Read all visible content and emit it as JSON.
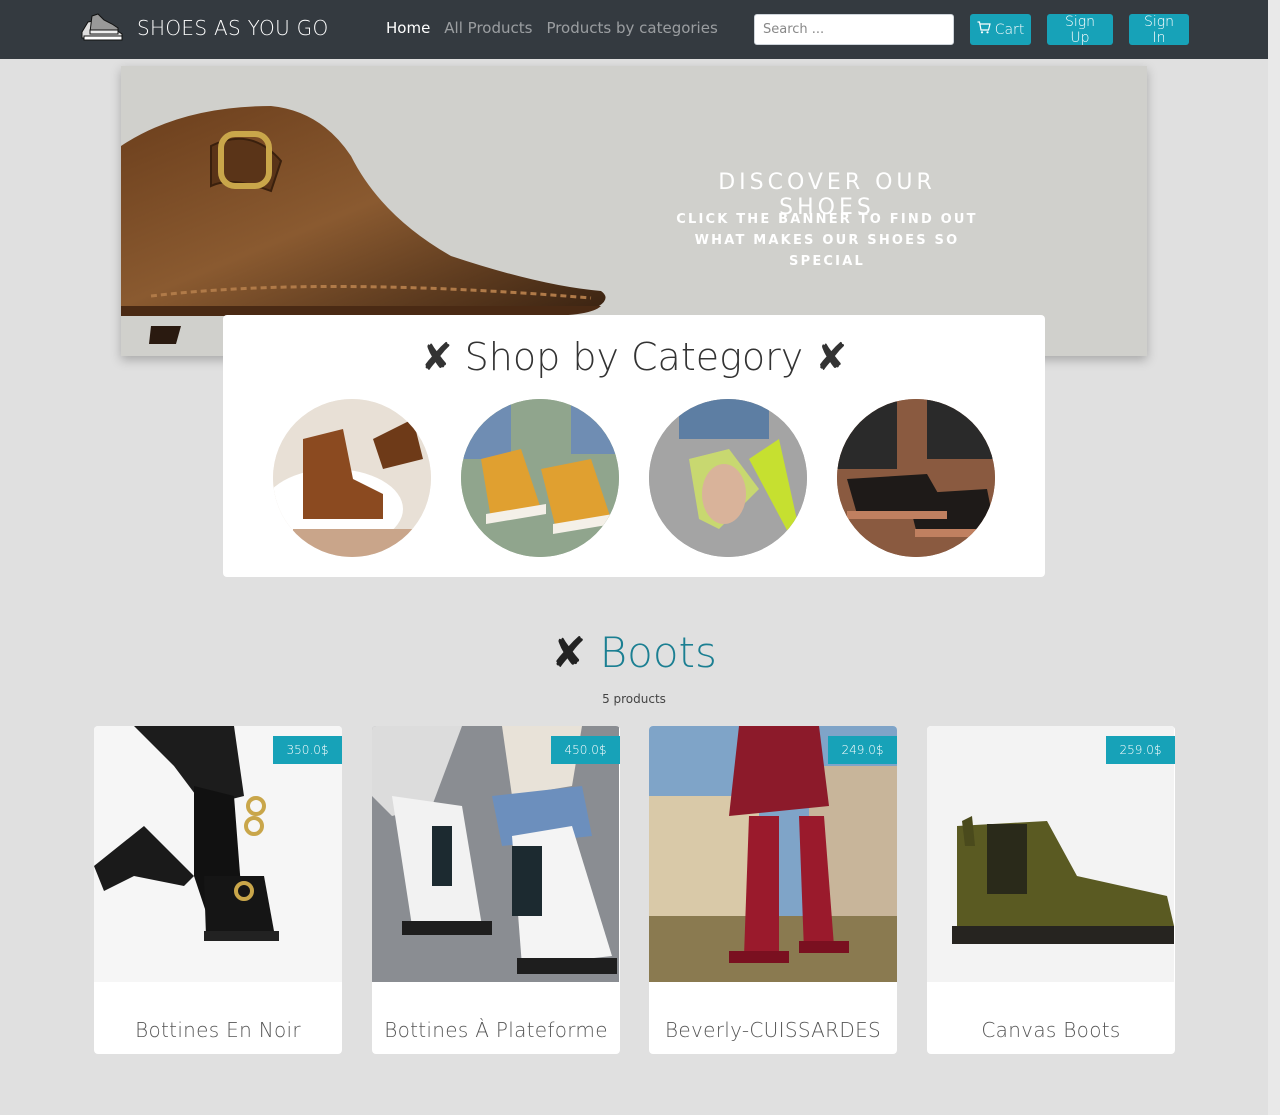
{
  "navbar": {
    "brand": "SHOES AS YOU GO",
    "links": [
      {
        "label": "Home",
        "active": true
      },
      {
        "label": "All Products",
        "active": false
      },
      {
        "label": "Products by categories",
        "active": false
      }
    ],
    "search_placeholder": "Search ...",
    "cart_label": "Cart",
    "signup_label": "Sign Up",
    "signin_label": "Sign In",
    "accent_color": "#17a2b8"
  },
  "banner": {
    "title": "DISCOVER OUR SHOES",
    "subtitle": "CLICK THE BANNER TO FIND OUT WHAT MAKES OUR SHOES SO SPECIAL"
  },
  "categories": {
    "title": "✘ Shop by Category ✘",
    "items": [
      {
        "icon": "brown-ankle-boot-photo"
      },
      {
        "icon": "yellow-sneakers-photo"
      },
      {
        "icon": "green-heels-photo"
      },
      {
        "icon": "black-loafers-photo"
      }
    ]
  },
  "section": {
    "mark": "✘",
    "title": "Boots",
    "count": "5 products"
  },
  "products": [
    {
      "name": "Bottines En Noir",
      "price": "350.0$"
    },
    {
      "name": "Bottines À Plateforme",
      "price": "450.0$"
    },
    {
      "name": "Beverly-CUISSARDES",
      "price": "249.0$"
    },
    {
      "name": "Canvas Boots",
      "price": "259.0$"
    }
  ]
}
